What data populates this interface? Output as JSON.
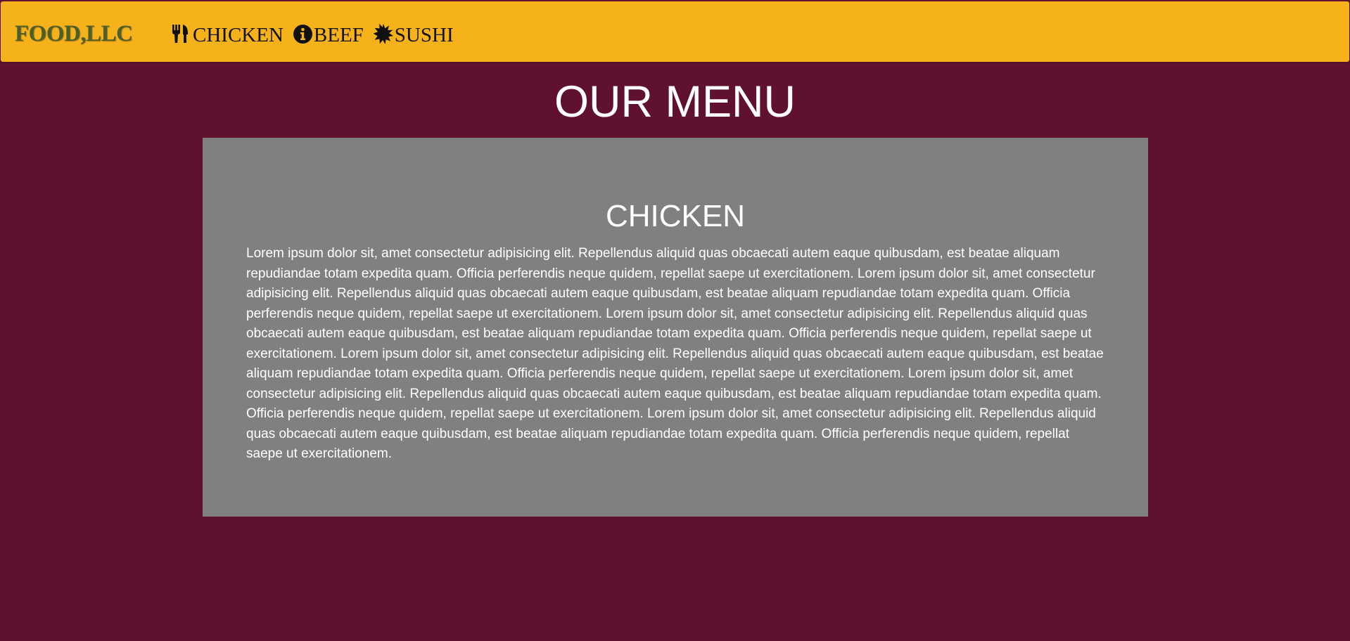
{
  "navbar": {
    "brand": "FOOD,LLC",
    "links": [
      {
        "icon": "utensils-icon",
        "label": "CHICKEN"
      },
      {
        "icon": "info-circle-icon",
        "label": "BEEF"
      },
      {
        "icon": "starburst-icon",
        "label": "SUSHI"
      }
    ]
  },
  "main": {
    "title": "OUR MENU",
    "section": {
      "title": "CHICKEN",
      "body": "Lorem ipsum dolor sit, amet consectetur adipisicing elit. Repellendus aliquid quas obcaecati autem eaque quibusdam, est beatae aliquam repudiandae totam expedita quam. Officia perferendis neque quidem, repellat saepe ut exercitationem. Lorem ipsum dolor sit, amet consectetur adipisicing elit. Repellendus aliquid quas obcaecati autem eaque quibusdam, est beatae aliquam repudiandae totam expedita quam. Officia perferendis neque quidem, repellat saepe ut exercitationem. Lorem ipsum dolor sit, amet consectetur adipisicing elit. Repellendus aliquid quas obcaecati autem eaque quibusdam, est beatae aliquam repudiandae totam expedita quam. Officia perferendis neque quidem, repellat saepe ut exercitationem. Lorem ipsum dolor sit, amet consectetur adipisicing elit. Repellendus aliquid quas obcaecati autem eaque quibusdam, est beatae aliquam repudiandae totam expedita quam. Officia perferendis neque quidem, repellat saepe ut exercitationem. Lorem ipsum dolor sit, amet consectetur adipisicing elit. Repellendus aliquid quas obcaecati autem eaque quibusdam, est beatae aliquam repudiandae totam expedita quam. Officia perferendis neque quidem, repellat saepe ut exercitationem. Lorem ipsum dolor sit, amet consectetur adipisicing elit. Repellendus aliquid quas obcaecati autem eaque quibusdam, est beatae aliquam repudiandae totam expedita quam. Officia perferendis neque quidem, repellat saepe ut exercitationem."
    }
  },
  "colors": {
    "background": "#60112f",
    "navbar": "#f5b21b",
    "brand": "#4a5f2a",
    "card": "#808080",
    "text": "#ffffff"
  }
}
